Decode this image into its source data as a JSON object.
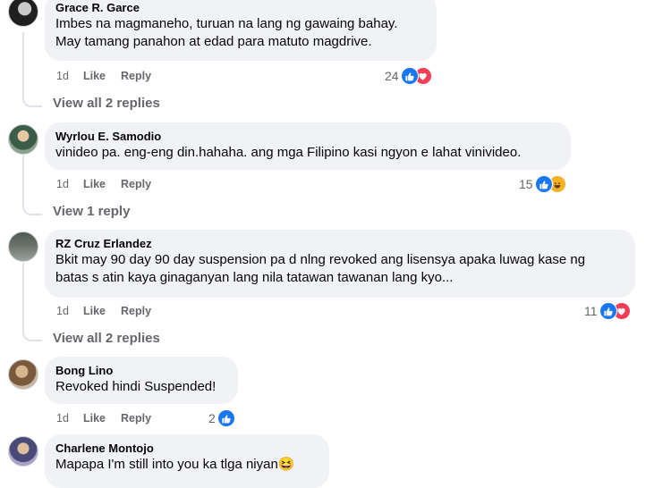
{
  "comments": [
    {
      "author": "Grace R. Garce",
      "lines": [
        "Imbes na magmaneho, turuan na lang ng gawaing bahay.",
        "May tamang panahon at edad para matuto magdrive."
      ],
      "time": "1d",
      "like": "Like",
      "reply": "Reply",
      "reaction_count": "24",
      "reactions": [
        "like",
        "love"
      ],
      "view_replies": "View all 2 replies"
    },
    {
      "author": "Wyrlou E. Samodio",
      "lines": [
        "vinideo pa. eng-eng din.hahaha. ang mga Filipino kasi ngyon e lahat vinivideo."
      ],
      "time": "1d",
      "like": "Like",
      "reply": "Reply",
      "reaction_count": "15",
      "reactions": [
        "like",
        "haha"
      ],
      "view_replies": "View 1 reply"
    },
    {
      "author": "RZ Cruz Erlandez",
      "lines": [
        "Bkit may 90 day 90 day suspension pa d nlng revoked ang lisensya apaka luwag kase ng",
        "batas s atin kaya ginaganyan lang nila tatawan tawanan lang kyo..."
      ],
      "time": "1d",
      "like": "Like",
      "reply": "Reply",
      "reaction_count": "11",
      "reactions": [
        "like",
        "love"
      ],
      "view_replies": "View all 2 replies"
    },
    {
      "author": "Bong Lino",
      "lines": [
        "Revoked hindi Suspended!"
      ],
      "time": "1d",
      "like": "Like",
      "reply": "Reply",
      "reaction_count": "2",
      "reactions": [
        "like"
      ]
    },
    {
      "author": "Charlene Montojo",
      "lines": [
        "Mapapa I'm still into you ka tlga niyan"
      ],
      "emoji": "😆"
    }
  ],
  "icons": {
    "like": "thumbs-up-icon",
    "love": "heart-icon",
    "haha": "laughing-face-icon"
  },
  "colors": {
    "like": "#1877f2",
    "love": "#f33e58",
    "haha": "#f7b125",
    "bubble": "#f0f2f5",
    "meta": "#65676b"
  }
}
